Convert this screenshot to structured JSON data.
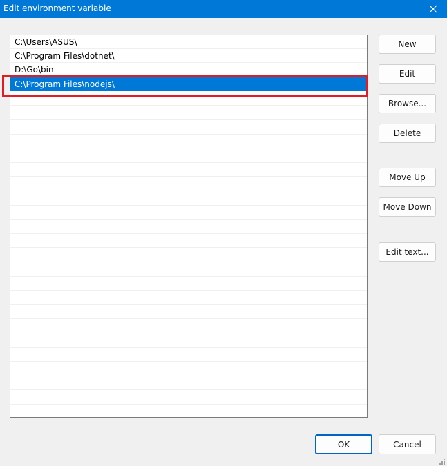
{
  "window": {
    "title": "Edit environment variable"
  },
  "list": {
    "items": [
      {
        "text": "C:\\Users\\ASUS\\",
        "selected": false
      },
      {
        "text": "C:\\Program Files\\dotnet\\",
        "selected": false
      },
      {
        "text": "D:\\Go\\bin",
        "selected": false
      },
      {
        "text": "C:\\Program Files\\nodejs\\",
        "selected": true
      }
    ],
    "empty_row_count": 23
  },
  "buttons": {
    "new": "New",
    "edit": "Edit",
    "browse": "Browse...",
    "delete": "Delete",
    "move_up": "Move Up",
    "move_down": "Move Down",
    "edit_text": "Edit text...",
    "ok": "OK",
    "cancel": "Cancel"
  },
  "icons": {
    "close": "close-icon",
    "resize": "resize-grip-icon"
  },
  "colors": {
    "accent": "#0078d7",
    "highlight": "#e41b23"
  }
}
